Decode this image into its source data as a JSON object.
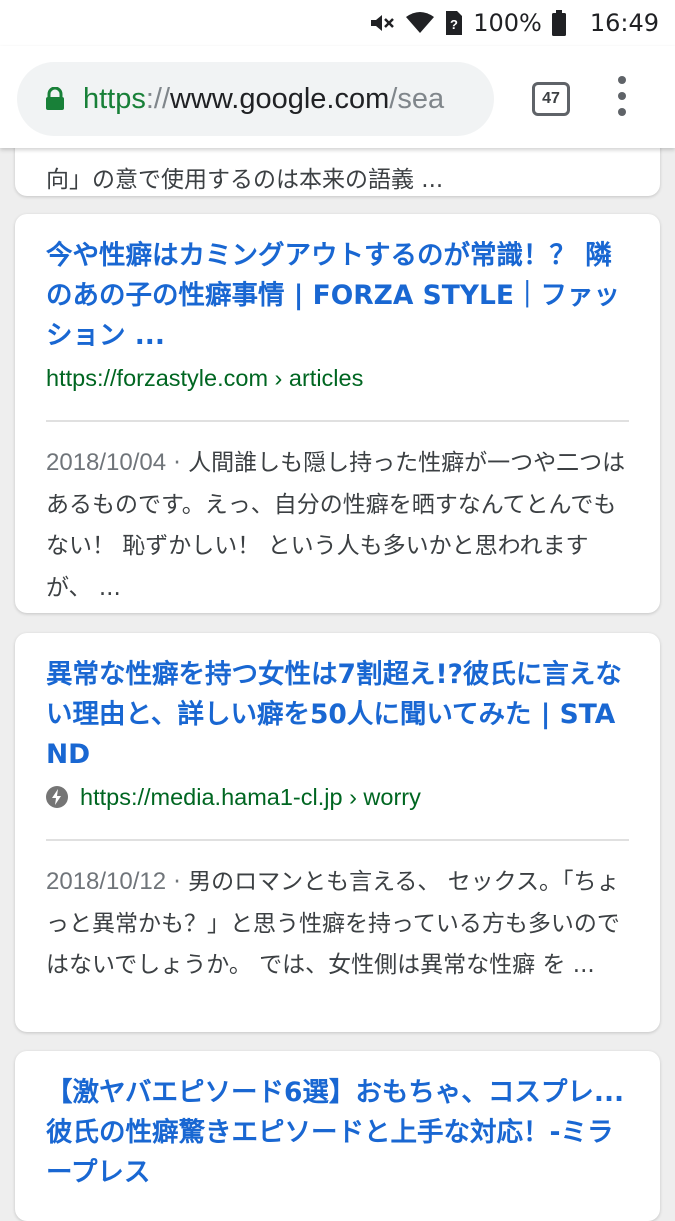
{
  "status_bar": {
    "battery": "100%",
    "time": "16:49",
    "icons": [
      "mute-icon",
      "wifi-icon",
      "no-sim-icon",
      "battery-icon"
    ]
  },
  "toolbar": {
    "url_scheme": "https",
    "url_separator": "://",
    "url_host": "www.google.com",
    "url_path": "/sea",
    "tab_count": "47",
    "icons": [
      "lock-icon",
      "tab-switcher-icon",
      "more-vert-icon"
    ]
  },
  "colors": {
    "link": "#1967d2",
    "url_green": "#006621",
    "snippet_text": "#3c4043",
    "date_gray": "#70757a",
    "lock_green": "#188038"
  },
  "results": {
    "prev_snippet": "向」の意で使用するのは本来の語義 ...",
    "r1": {
      "title": "今や性癖はカミングアウトするのが常識！？ 隣のあの子の性癖事情 | FORZA STYLE｜ファッション ...",
      "url": "https://forzastyle.com › articles",
      "date": "2018/10/04",
      "sep": " · ",
      "snippet": "人間誰しも隠し持った性癖が一つや二つはあるものです。えっ、自分の性癖を晒すなんてとんでもない！ 恥ずかしい！ という人も多いかと思われますが、 ..."
    },
    "r2": {
      "title": "異常な性癖を持つ女性は7割超え!?彼氏に言えない理由と、詳しい癖を50人に聞いてみた | STAND",
      "url": "https://media.hama1-cl.jp › worry",
      "date": "2018/10/12",
      "sep": " · ",
      "snippet": "男のロマンとも言える、 セックス。「ちょっと異常かも？」と思う性癖を持っている方も多いのではないでしょうか。 では、女性側は異常な性癖 を ..."
    },
    "r3": {
      "title": "【激ヤバエピソード6選】おもちゃ、コスプレ...彼氏の性癖驚きエピソードと上手な対応！-ミラープレス"
    }
  }
}
